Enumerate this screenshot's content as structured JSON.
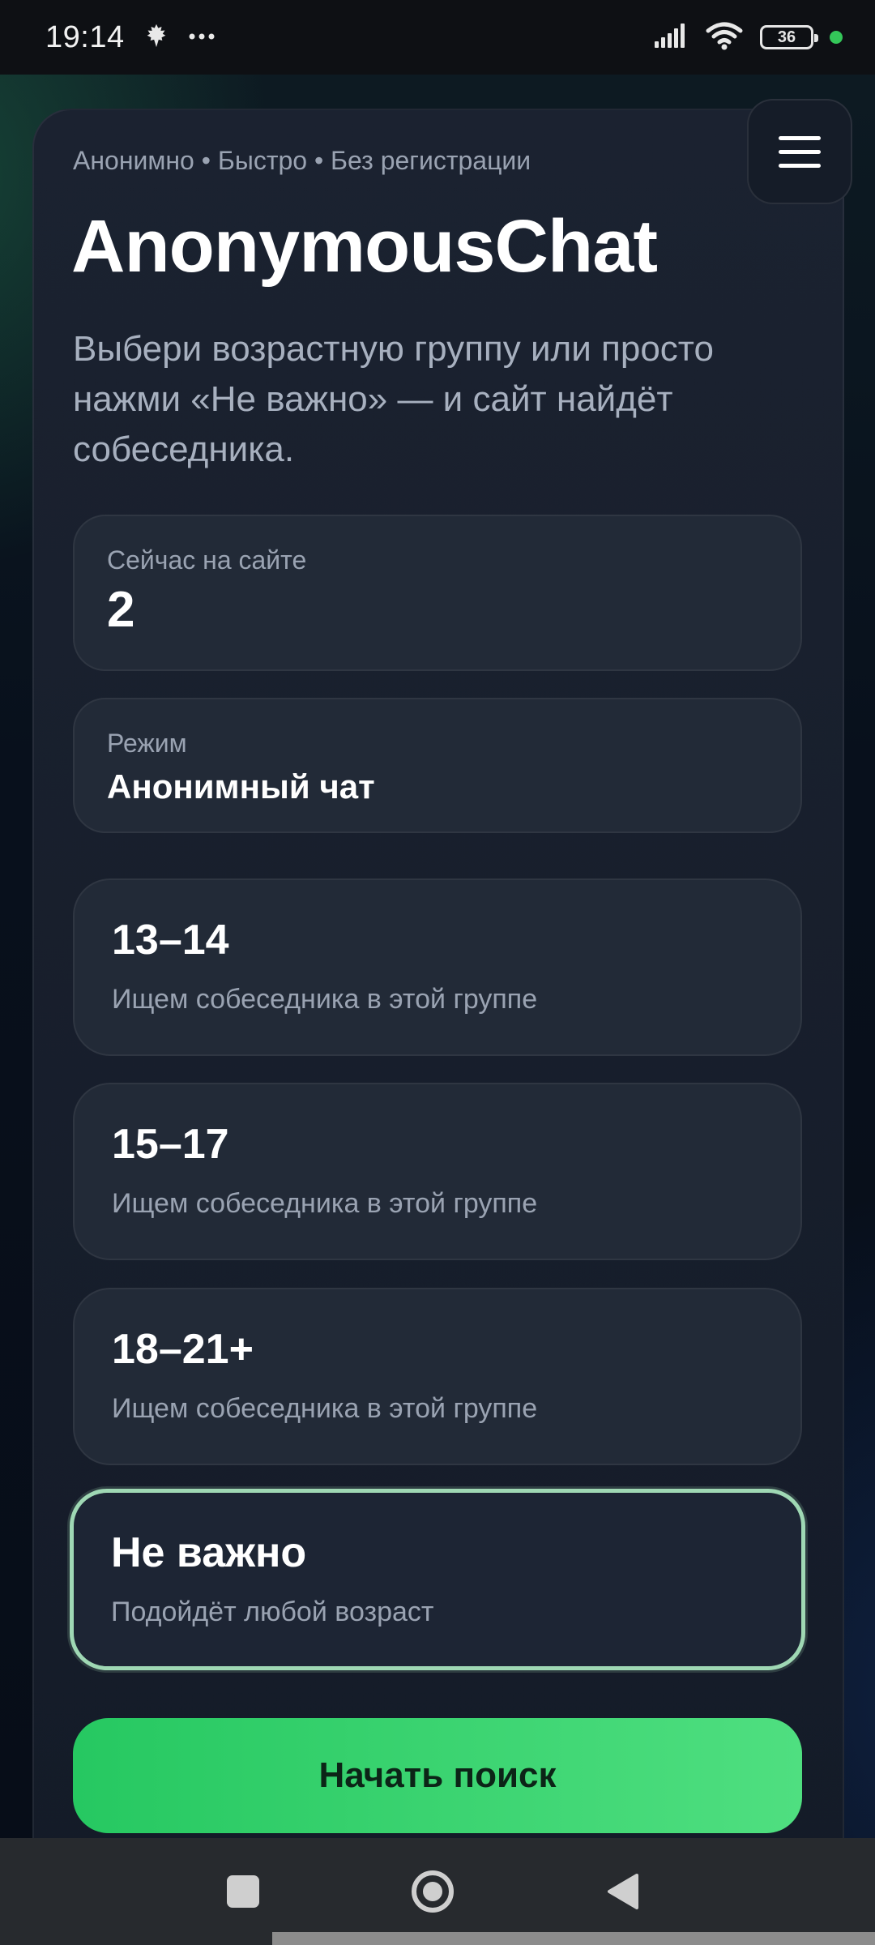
{
  "status_bar": {
    "time": "19:14",
    "notification_icons": [
      "maple-leaf-icon",
      "more-dots-icon"
    ],
    "battery_level": "36",
    "indicator_color": "#34c759"
  },
  "header": {
    "tagline": "Анонимно • Быстро • Без регистрации",
    "title": "AnonymousChat",
    "description": "Выбери возрастную группу или просто нажми «Не важно» — и сайт найдёт собеседника."
  },
  "stats": {
    "online_label": "Сейчас на сайте",
    "online_value": "2",
    "mode_label": "Режим",
    "mode_value": "Анонимный чат"
  },
  "age_options": [
    {
      "title": "13–14",
      "subtitle": "Ищем собеседника в этой группе",
      "selected": false
    },
    {
      "title": "15–17",
      "subtitle": "Ищем собеседника в этой группе",
      "selected": false
    },
    {
      "title": "18–21+",
      "subtitle": "Ищем собеседника в этой группе",
      "selected": false
    },
    {
      "title": "Не важно",
      "subtitle": "Подойдёт любой возраст",
      "selected": true
    }
  ],
  "actions": {
    "start_search_label": "Начать поиск"
  },
  "colors": {
    "accent_green": "#2fcf68",
    "selected_border": "#9fd8b4",
    "card_background": "#1b2230"
  }
}
